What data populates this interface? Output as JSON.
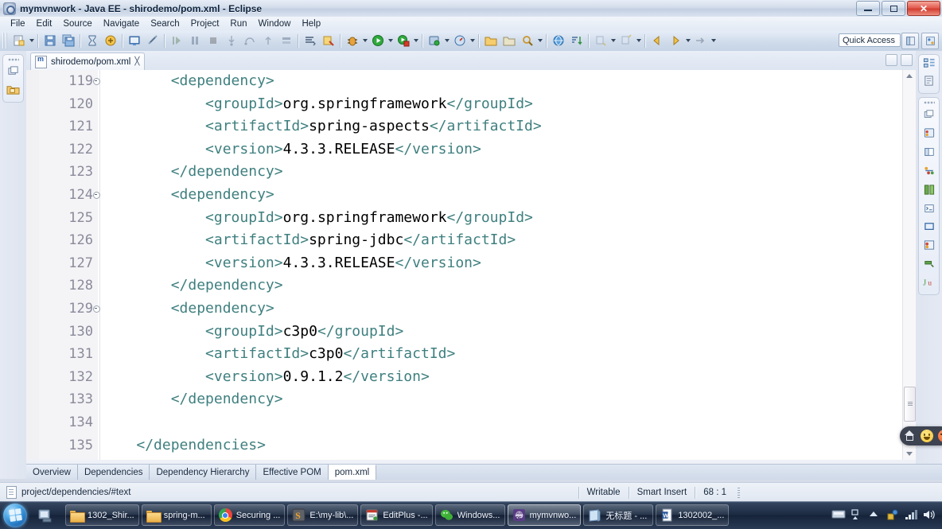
{
  "window": {
    "title": "mymvnwork - Java EE - shirodemo/pom.xml - Eclipse",
    "app_icon": "eclipse-icon",
    "controls": {
      "minimize": "–",
      "maximize": "❐",
      "close": "✕"
    }
  },
  "menubar": {
    "items": [
      {
        "label": "File",
        "mnemonic": "F"
      },
      {
        "label": "Edit",
        "mnemonic": "E"
      },
      {
        "label": "Source",
        "mnemonic": "S"
      },
      {
        "label": "Navigate",
        "mnemonic": "N"
      },
      {
        "label": "Search",
        "mnemonic": "a"
      },
      {
        "label": "Project",
        "mnemonic": "P"
      },
      {
        "label": "Run",
        "mnemonic": "R"
      },
      {
        "label": "Window",
        "mnemonic": "W"
      },
      {
        "label": "Help",
        "mnemonic": "H"
      }
    ]
  },
  "toolbar": {
    "quick_access_placeholder": "Quick Access",
    "groups": [
      {
        "buttons": [
          {
            "name": "new-wizard-icon",
            "has_dropdown": true
          },
          {
            "name": "save-icon",
            "has_dropdown": false
          },
          {
            "name": "save-all-icon",
            "has_dropdown": false
          }
        ]
      },
      {
        "buttons": [
          {
            "name": "hourglass-icon",
            "has_dropdown": false
          },
          {
            "name": "build-icon",
            "has_dropdown": false
          }
        ]
      },
      {
        "buttons": [
          {
            "name": "terminal-icon",
            "has_dropdown": false
          },
          {
            "name": "link-break-icon",
            "has_dropdown": false
          }
        ]
      },
      {
        "buttons": [
          {
            "name": "resume-icon",
            "has_dropdown": false
          },
          {
            "name": "pause-icon",
            "has_dropdown": false
          },
          {
            "name": "terminate-icon",
            "has_dropdown": false
          },
          {
            "name": "step-into-icon",
            "has_dropdown": false
          },
          {
            "name": "step-over-icon",
            "has_dropdown": false
          },
          {
            "name": "step-return-icon",
            "has_dropdown": false
          },
          {
            "name": "drop-to-frame-icon",
            "has_dropdown": false
          }
        ]
      },
      {
        "buttons": [
          {
            "name": "console-icon",
            "has_dropdown": false
          },
          {
            "name": "coverage-icon",
            "has_dropdown": false
          }
        ]
      },
      {
        "buttons": [
          {
            "name": "debug-icon",
            "has_dropdown": true
          },
          {
            "name": "run-icon",
            "has_dropdown": true
          },
          {
            "name": "run-external-icon",
            "has_dropdown": true
          }
        ]
      },
      {
        "buttons": [
          {
            "name": "server-icon",
            "has_dropdown": true
          },
          {
            "name": "profile-icon",
            "has_dropdown": true
          }
        ]
      },
      {
        "buttons": [
          {
            "name": "open-folder-icon",
            "has_dropdown": false
          },
          {
            "name": "open-type-icon",
            "has_dropdown": false
          },
          {
            "name": "search-icon",
            "has_dropdown": false
          },
          {
            "name": "marker-icon",
            "has_dropdown": true
          }
        ]
      },
      {
        "buttons": [
          {
            "name": "web-browser-icon",
            "has_dropdown": false
          },
          {
            "name": "sort-icon",
            "has_dropdown": false
          }
        ]
      },
      {
        "buttons": [
          {
            "name": "next-annotation-icon",
            "has_dropdown": true
          },
          {
            "name": "previous-annotation-icon",
            "has_dropdown": true
          }
        ]
      },
      {
        "buttons": [
          {
            "name": "back-arrow-icon",
            "has_dropdown": false
          },
          {
            "name": "forward-arrow-icon",
            "has_dropdown": true
          },
          {
            "name": "right-arrow-icon",
            "has_dropdown": true
          }
        ]
      }
    ],
    "perspective_buttons": [
      {
        "name": "open-perspective-icon"
      },
      {
        "name": "java-ee-perspective-icon"
      }
    ]
  },
  "left_rail": {
    "icons": [
      {
        "name": "restore-view-icon"
      },
      {
        "name": "project-explorer-icon"
      }
    ]
  },
  "right_rail": {
    "top_icons": [
      {
        "name": "outline-view-icon"
      },
      {
        "name": "task-list-icon"
      }
    ],
    "icons": [
      {
        "name": "restore-view-icon"
      },
      {
        "name": "servers-view-icon"
      },
      {
        "name": "properties-view-icon"
      },
      {
        "name": "data-source-explorer-icon"
      },
      {
        "name": "snippets-view-icon"
      },
      {
        "name": "console-view-icon"
      },
      {
        "name": "terminal-view-icon"
      },
      {
        "name": "markers-view-icon"
      },
      {
        "name": "progress-view-icon"
      },
      {
        "name": "junit-view-icon"
      }
    ]
  },
  "editor": {
    "tab": {
      "title": "shirodemo/pom.xml",
      "icon": "maven-pom-icon",
      "close_label": "╳"
    },
    "view_buttons": [
      {
        "name": "minimize-editor-icon"
      },
      {
        "name": "maximize-editor-icon"
      }
    ],
    "first_line_number": 119,
    "lines": [
      {
        "num": "119",
        "fold": true,
        "indent": 8,
        "segments": [
          {
            "t": "tag",
            "s": "<dependency>"
          }
        ]
      },
      {
        "num": "120",
        "fold": false,
        "indent": 12,
        "segments": [
          {
            "t": "tag",
            "s": "<groupId>"
          },
          {
            "t": "text",
            "s": "org.springframework"
          },
          {
            "t": "tag",
            "s": "</groupId>"
          }
        ]
      },
      {
        "num": "121",
        "fold": false,
        "indent": 12,
        "segments": [
          {
            "t": "tag",
            "s": "<artifactId>"
          },
          {
            "t": "text",
            "s": "spring-aspects"
          },
          {
            "t": "tag",
            "s": "</artifactId>"
          }
        ]
      },
      {
        "num": "122",
        "fold": false,
        "indent": 12,
        "segments": [
          {
            "t": "tag",
            "s": "<version>"
          },
          {
            "t": "text",
            "s": "4.3.3.RELEASE"
          },
          {
            "t": "tag",
            "s": "</version>"
          }
        ]
      },
      {
        "num": "123",
        "fold": false,
        "indent": 8,
        "segments": [
          {
            "t": "tag",
            "s": "</dependency>"
          }
        ]
      },
      {
        "num": "124",
        "fold": true,
        "indent": 8,
        "segments": [
          {
            "t": "tag",
            "s": "<dependency>"
          }
        ]
      },
      {
        "num": "125",
        "fold": false,
        "indent": 12,
        "segments": [
          {
            "t": "tag",
            "s": "<groupId>"
          },
          {
            "t": "text",
            "s": "org.springframework"
          },
          {
            "t": "tag",
            "s": "</groupId>"
          }
        ]
      },
      {
        "num": "126",
        "fold": false,
        "indent": 12,
        "segments": [
          {
            "t": "tag",
            "s": "<artifactId>"
          },
          {
            "t": "text",
            "s": "spring-jdbc"
          },
          {
            "t": "tag",
            "s": "</artifactId>"
          }
        ]
      },
      {
        "num": "127",
        "fold": false,
        "indent": 12,
        "segments": [
          {
            "t": "tag",
            "s": "<version>"
          },
          {
            "t": "text",
            "s": "4.3.3.RELEASE"
          },
          {
            "t": "tag",
            "s": "</version>"
          }
        ]
      },
      {
        "num": "128",
        "fold": false,
        "indent": 8,
        "segments": [
          {
            "t": "tag",
            "s": "</dependency>"
          }
        ]
      },
      {
        "num": "129",
        "fold": true,
        "indent": 8,
        "segments": [
          {
            "t": "tag",
            "s": "<dependency>"
          }
        ]
      },
      {
        "num": "130",
        "fold": false,
        "indent": 12,
        "segments": [
          {
            "t": "tag",
            "s": "<groupId>"
          },
          {
            "t": "text",
            "s": "c3p0"
          },
          {
            "t": "tag",
            "s": "</groupId>"
          }
        ]
      },
      {
        "num": "131",
        "fold": false,
        "indent": 12,
        "segments": [
          {
            "t": "tag",
            "s": "<artifactId>"
          },
          {
            "t": "text",
            "s": "c3p0"
          },
          {
            "t": "tag",
            "s": "</artifactId>"
          }
        ]
      },
      {
        "num": "132",
        "fold": false,
        "indent": 12,
        "segments": [
          {
            "t": "tag",
            "s": "<version>"
          },
          {
            "t": "text",
            "s": "0.9.1.2"
          },
          {
            "t": "tag",
            "s": "</version>"
          }
        ]
      },
      {
        "num": "133",
        "fold": false,
        "indent": 8,
        "segments": [
          {
            "t": "tag",
            "s": "</dependency>"
          }
        ]
      },
      {
        "num": "134",
        "fold": false,
        "indent": 0,
        "segments": []
      },
      {
        "num": "135",
        "fold": false,
        "indent": 4,
        "segments": [
          {
            "t": "tag",
            "s": "</dependencies>"
          }
        ]
      }
    ],
    "syntax_colors": {
      "tag": "#3f7f7f",
      "text": "#000000",
      "line_number": "#8a8a9a",
      "background": "#ffffff"
    }
  },
  "form_tabs": {
    "items": [
      {
        "label": "Overview",
        "active": false
      },
      {
        "label": "Dependencies",
        "active": false
      },
      {
        "label": "Dependency Hierarchy",
        "active": false
      },
      {
        "label": "Effective POM",
        "active": false
      },
      {
        "label": "pom.xml",
        "active": true
      }
    ]
  },
  "statusbar": {
    "path": "project/dependencies/#text",
    "writable": "Writable",
    "insert_mode": "Smart Insert",
    "position": "68 : 1"
  },
  "taskbar": {
    "start_label": "start-orb",
    "quick_launch": [
      {
        "name": "show-desktop-icon"
      }
    ],
    "tasks": [
      {
        "label": "1302_Shir...",
        "icon": "folder-icon",
        "active": false
      },
      {
        "label": "spring-m...",
        "icon": "folder-icon",
        "active": false
      },
      {
        "label": "Securing ...",
        "icon": "chrome-icon",
        "active": false
      },
      {
        "label": "E:\\my-lib\\...",
        "icon": "sublime-icon",
        "active": false
      },
      {
        "label": "EditPlus -...",
        "icon": "editplus-icon",
        "active": false
      },
      {
        "label": "Windows...",
        "icon": "wechat-icon",
        "active": false
      },
      {
        "label": "mymvnwo...",
        "icon": "eclipse-icon",
        "active": true
      },
      {
        "label": "无标题 - ...",
        "icon": "notepad-icon",
        "active": false
      },
      {
        "label": "1302002_...",
        "icon": "word-icon",
        "active": false
      }
    ],
    "tray": [
      {
        "name": "keyboard-layout-icon"
      },
      {
        "name": "show-hidden-icons-icon"
      },
      {
        "name": "safely-remove-icon"
      },
      {
        "name": "security-icon"
      },
      {
        "name": "network-icon"
      },
      {
        "name": "volume-icon"
      }
    ]
  },
  "overlay_widget": {
    "icons": [
      {
        "name": "home-icon"
      },
      {
        "name": "smiley-face-icon"
      },
      {
        "name": "angry-face-icon"
      }
    ]
  }
}
